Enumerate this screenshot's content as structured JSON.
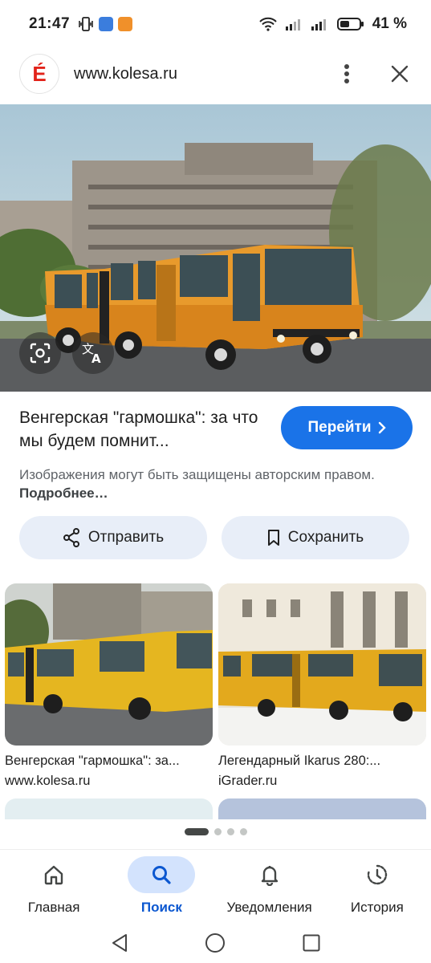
{
  "status_bar": {
    "time": "21:47",
    "battery": "41 %"
  },
  "site": {
    "logo_letter": "É",
    "url": "www.kolesa.ru"
  },
  "result": {
    "title": "Венгерская \"гармошка\": за что мы будем помнит...",
    "visit_label": "Перейти",
    "copyright_text": "Изображения могут быть защищены авторским правом.",
    "more_link": "Подробнее…"
  },
  "actions": {
    "share_label": "Отправить",
    "save_label": "Сохранить"
  },
  "related": [
    {
      "title": "Венгерская \"гармошка\": за...",
      "source": "www.kolesa.ru"
    },
    {
      "title": "Легендарный Ikarus 280:...",
      "source": "iGrader.ru"
    }
  ],
  "nav": {
    "items": [
      {
        "label": "Главная",
        "icon": "home-icon"
      },
      {
        "label": "Поиск",
        "icon": "search-icon"
      },
      {
        "label": "Уведомления",
        "icon": "bell-icon"
      },
      {
        "label": "История",
        "icon": "history-icon"
      }
    ],
    "active_index": 1
  },
  "colors": {
    "accent": "#1a73e8",
    "pill_bg": "#e8eef8",
    "nav_active_bg": "#d3e3fd",
    "logo_red": "#e2231a"
  }
}
